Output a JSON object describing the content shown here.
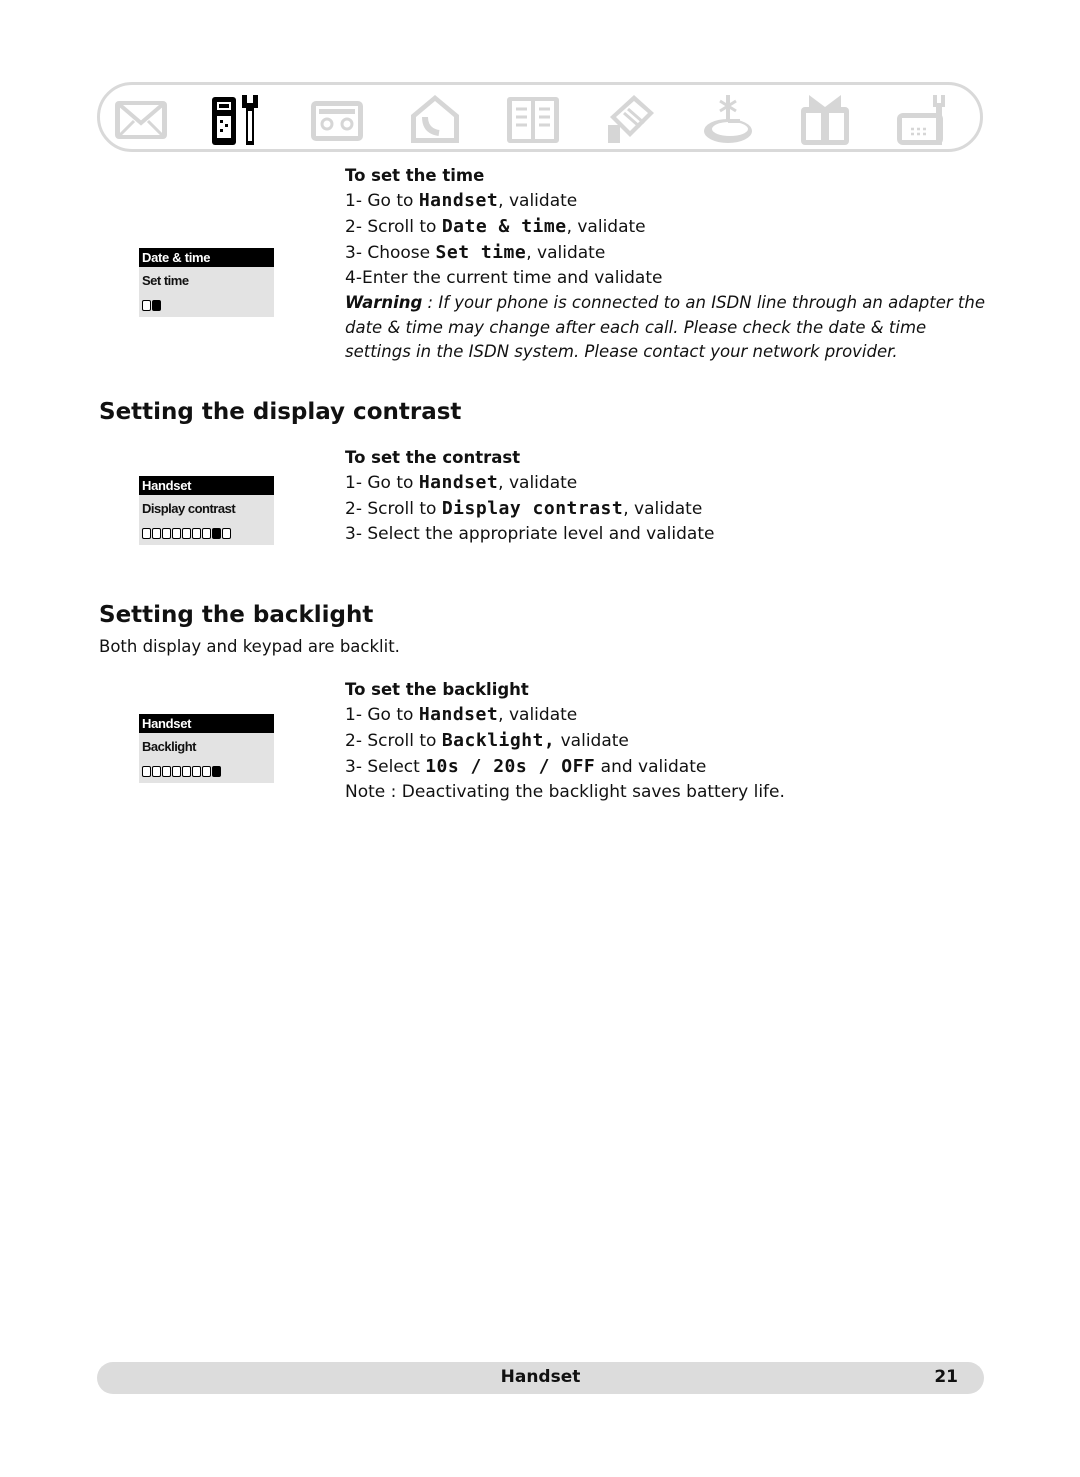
{
  "header": {
    "menu_icons": [
      {
        "name": "messages",
        "active": false
      },
      {
        "name": "handset-settings",
        "active": true
      },
      {
        "name": "answering-machine",
        "active": false
      },
      {
        "name": "home-phone",
        "active": false
      },
      {
        "name": "phonebook",
        "active": false
      },
      {
        "name": "call-log",
        "active": false
      },
      {
        "name": "network-services",
        "active": false
      },
      {
        "name": "extras",
        "active": false
      },
      {
        "name": "base-settings",
        "active": false
      }
    ]
  },
  "time_section": {
    "screen": {
      "title": "Date & time",
      "item": "Set time",
      "level_cells": 2,
      "level_selected": 2
    },
    "subheading": "To set the time",
    "steps": [
      {
        "prefix": "1- Go to ",
        "lcd": "Handset",
        "suffix": ", validate"
      },
      {
        "prefix": "2- Scroll to ",
        "lcd": "Date & time",
        "suffix": ", validate"
      },
      {
        "prefix": "3- Choose ",
        "lcd": "Set time",
        "suffix": ", validate"
      },
      {
        "prefix": "4-Enter the current time and validate",
        "lcd": "",
        "suffix": ""
      }
    ],
    "warning_label": "Warning",
    "warning_text": " : If your phone is connected to an ISDN line through an adapter the date & time may change after each call. Please check the date & time settings in the ISDN system. Please contact your network provider."
  },
  "contrast_section": {
    "heading": "Setting the display contrast",
    "screen": {
      "title": "Handset",
      "item": "Display contrast",
      "level_cells": 9,
      "level_selected": 8
    },
    "subheading": "To set the contrast",
    "steps": [
      {
        "prefix": "1- Go to ",
        "lcd": "Handset",
        "suffix": ", validate"
      },
      {
        "prefix": "2- Scroll to ",
        "lcd": "Display contrast",
        "suffix": ", validate"
      },
      {
        "prefix": "3- Select the appropriate level and validate",
        "lcd": "",
        "suffix": ""
      }
    ]
  },
  "backlight_section": {
    "heading": "Setting the backlight",
    "intro": "Both display and keypad are backlit.",
    "screen": {
      "title": "Handset",
      "item": "Backlight",
      "level_cells": 8,
      "level_selected": 8
    },
    "subheading": "To set the backlight",
    "steps": [
      {
        "prefix": "1- Go to ",
        "lcd": "Handset",
        "suffix": ", validate"
      },
      {
        "prefix": "2- Scroll to ",
        "lcd": "Backlight,",
        "suffix": " validate"
      },
      {
        "prefix": "3- Select ",
        "lcd": "10s / 20s / OFF",
        "suffix": " and validate"
      },
      {
        "prefix": "Note : Deactivating the backlight saves battery life.",
        "lcd": "",
        "suffix": ""
      }
    ]
  },
  "footer": {
    "title": "Handset",
    "page": "21"
  },
  "colors": {
    "inactive_icon": "#d6d6d6",
    "active_icon": "#000000",
    "lcd_bg": "#e3e3e3",
    "footer_bg": "#dcdcdc"
  }
}
